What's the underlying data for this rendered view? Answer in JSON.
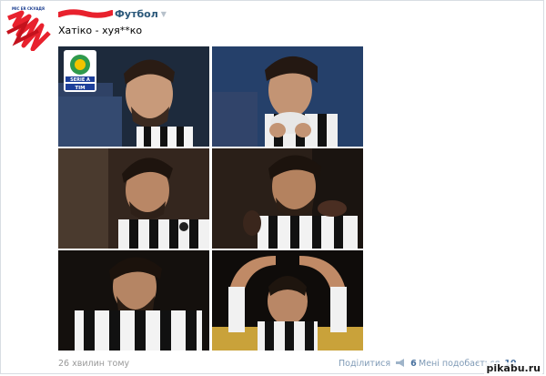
{
  "post": {
    "author_suffix": "Футбол",
    "text": "Хатiко - хуя**ко",
    "avatar_caption": "MIC ER СКУАДЯ"
  },
  "images": {
    "league_badge_top": "SERIE A",
    "league_badge_bottom": "TIM"
  },
  "footer": {
    "time": "26 хвилин тому",
    "share_label": "Поділитися",
    "share_count": "6",
    "like_label": "Мені подобається",
    "like_count": "10"
  },
  "watermark": "pikabu.ru",
  "colors": {
    "link": "#2b587a",
    "meta": "#999999",
    "action": "#7f9ab6",
    "redaction": "#e8212d"
  },
  "icons": [
    "dropdown-arrow-icon",
    "megaphone-icon",
    "heart-icon"
  ]
}
